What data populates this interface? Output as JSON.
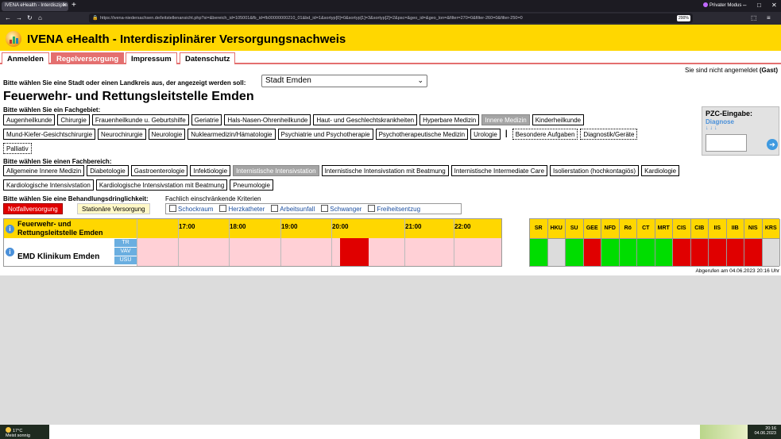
{
  "browser": {
    "tab_title": "IVENA eHealth - Interdisziplin",
    "private_label": "Privater Modus",
    "url": "https://ivena-niedersachsen.de/leitstellenansicht.php?si=&bereich_id=105001&fb_id=fb00000000210_01&bd_id=1&sortyp[0]=0&sortyp[1]=3&sortyp[2]=2&psc=&geo_id=&geo_lon=&filter=270=0&filter-260=0&filter-250=0",
    "zoom": "200%"
  },
  "header": {
    "title": "IVENA eHealth - Interdisziplinärer Versorgungsnachweis"
  },
  "menu": [
    {
      "label": "Anmelden",
      "active": false
    },
    {
      "label": "Regelversorgung",
      "active": true
    },
    {
      "label": "Impressum",
      "active": false
    },
    {
      "label": "Datenschutz",
      "active": false
    }
  ],
  "login_status": {
    "text": "Sie sind nicht angemeldet ",
    "user": "(Gast)"
  },
  "stadt": {
    "label": "Bitte wählen Sie eine Stadt oder einen Landkreis aus, der angezeigt werden soll:",
    "selected": "Stadt Emden"
  },
  "leitstelle": "Feuerwehr- und Rettungsleitstelle Emden",
  "fachgebiet": {
    "label": "Bitte wählen Sie ein Fachgebiet:",
    "row1": [
      "Augenheilkunde",
      "Chirurgie",
      "Frauenheilkunde u. Geburtshilfe",
      "Geriatrie",
      "Hals-Nasen-Ohrenheilkunde",
      "Haut- und Geschlechtskrankheiten",
      "Hyperbare Medizin",
      "Innere Medizin",
      "Kinderheilkunde"
    ],
    "row2": [
      "Mund-Kiefer-Gesichtschirurgie",
      "Neurochirurgie",
      "Neurologie",
      "Nuklearmedizin/Hämatologie",
      "Psychiatrie und Psychotherapie",
      "Psychotherapeutische Medizin",
      "Urologie"
    ],
    "row2_sep": "|",
    "row2_extra": [
      "Besondere Aufgaben",
      "Diagnostik/Geräte"
    ],
    "row3": [
      "Palliativ"
    ],
    "selected": "Innere Medizin"
  },
  "fachbereich": {
    "label": "Bitte wählen Sie einen Fachbereich:",
    "row1": [
      "Allgemeine Innere Medizin",
      "Diabetologie",
      "Gastroenterologie",
      "Infektiologie",
      "Internistische Intensivstation",
      "Internistische Intensivstation mit Beatmung",
      "Internistische Intermediate Care",
      "Isolierstation (hochkontagiös)",
      "Kardiologie"
    ],
    "row2": [
      "Kardiologische Intensivstation",
      "Kardiologische Intensivstation mit Beatmung",
      "Pneumologie"
    ],
    "selected": "Internistische Intensivstation"
  },
  "dringlichkeit": {
    "label": "Bitte wählen Sie eine Behandlungsdringlichkeit:",
    "notfall": "Notfallversorgung",
    "stationaer": "Stationäre Versorgung"
  },
  "kriterien": {
    "label": "Fachlich einschränkende Kriterien",
    "items": [
      "Schockraum",
      "Herzkatheter",
      "Arbeitsunfall",
      "Schwanger",
      "Freiheitsentzug"
    ]
  },
  "pzc": {
    "title": "PZC-Eingabe:",
    "diagnose": "Diagnose",
    "arrows": "↓↓↓",
    "input_value": ""
  },
  "timeline": {
    "header_name": "Feuerwehr- und Rettungsleitstelle Emden",
    "times": [
      "17:00",
      "18:00",
      "19:00",
      "20:00",
      "21:00",
      "22:00"
    ],
    "hospital": "EMD Klinikum Emden",
    "profiles": [
      "TR",
      "VAV",
      "USU"
    ],
    "info": "i",
    "red_slot_time": "20:00"
  },
  "status": {
    "columns": [
      "SR",
      "HKU",
      "SU",
      "GEE",
      "NFD",
      "Rö",
      "CT",
      "MRT",
      "CIS",
      "CIB",
      "IIS",
      "IIB",
      "NIS",
      "KRS"
    ],
    "values": [
      "green",
      "grey",
      "green",
      "red",
      "green",
      "green",
      "green",
      "green",
      "red",
      "red",
      "red",
      "red",
      "red",
      "grey"
    ],
    "colors": {
      "green": "#00dd00",
      "red": "#e00000",
      "grey": "#dcdcdc"
    }
  },
  "abgerufen": "Abgerufen am 04.06.2023 20:16 Uhr",
  "taskbar": {
    "weather_temp": "17°C",
    "weather_desc": "Meist sonnig",
    "time": "20:16",
    "date": "04.06.2023"
  }
}
